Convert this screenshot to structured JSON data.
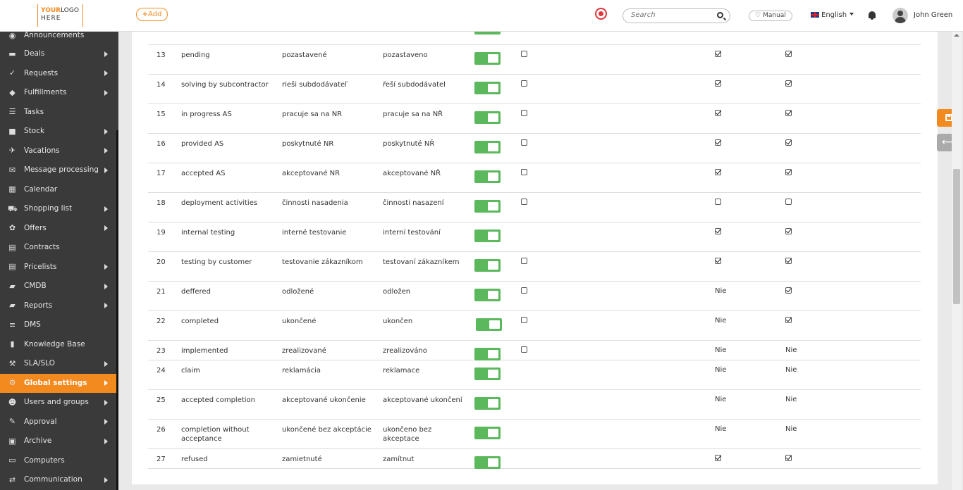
{
  "header": {
    "logo_line1_a": "YOUR",
    "logo_line1_b": "LOGO",
    "logo_line2": "HERE",
    "add_label": "Add",
    "search_placeholder": "Search",
    "manual_label": "Manual",
    "language": "English",
    "username": "John Green"
  },
  "sidebar": {
    "items": [
      {
        "label": "Announcements",
        "icon": "◉",
        "arrow": false
      },
      {
        "label": "Deals",
        "icon": "▬",
        "arrow": true
      },
      {
        "label": "Requests",
        "icon": "✓",
        "arrow": true
      },
      {
        "label": "Fulfillments",
        "icon": "◆",
        "arrow": true
      },
      {
        "label": "Tasks",
        "icon": "☰",
        "arrow": false
      },
      {
        "label": "Stock",
        "icon": "■",
        "arrow": true
      },
      {
        "label": "Vacations",
        "icon": "✈",
        "arrow": true
      },
      {
        "label": "Message processing",
        "icon": "✉",
        "arrow": true
      },
      {
        "label": "Calendar",
        "icon": "▦",
        "arrow": false
      },
      {
        "label": "Shopping list",
        "icon": "⛟",
        "arrow": true
      },
      {
        "label": "Offers",
        "icon": "✿",
        "arrow": true
      },
      {
        "label": "Contracts",
        "icon": "▤",
        "arrow": false
      },
      {
        "label": "Pricelists",
        "icon": "▤",
        "arrow": true
      },
      {
        "label": "CMDB",
        "icon": "▰",
        "arrow": true
      },
      {
        "label": "Reports",
        "icon": "▰",
        "arrow": true
      },
      {
        "label": "DMS",
        "icon": "≡",
        "arrow": false
      },
      {
        "label": "Knowledge Base",
        "icon": "▮",
        "arrow": false
      },
      {
        "label": "SLA/SLO",
        "icon": "⚒",
        "arrow": true
      },
      {
        "label": "Global settings",
        "icon": "⚙",
        "arrow": true,
        "active": true
      },
      {
        "label": "Users and groups",
        "icon": "☻",
        "arrow": true
      },
      {
        "label": "Approval",
        "icon": "✎",
        "arrow": true
      },
      {
        "label": "Archive",
        "icon": "▣",
        "arrow": true
      },
      {
        "label": "Computers",
        "icon": "▭",
        "arrow": false
      },
      {
        "label": "Communication",
        "icon": "⇄",
        "arrow": true
      }
    ]
  },
  "table": {
    "rows": [
      {
        "num": "13",
        "en": "pending",
        "sk": "pozastavené",
        "cz": "pozastaveno",
        "cb": true,
        "m1": "on",
        "m2": "on",
        "h": 42
      },
      {
        "num": "14",
        "en": "solving by subcontractor",
        "sk": "rieši subdodávateľ",
        "cz": "řeší subdodávatel",
        "cb": true,
        "m1": "on",
        "m2": "on",
        "h": 42
      },
      {
        "num": "15",
        "en": "in progress AS",
        "sk": "pracuje sa na NR",
        "cz": "pracuje sa na NŘ",
        "cb": true,
        "m1": "on",
        "m2": "on",
        "h": 42
      },
      {
        "num": "16",
        "en": "provided AS",
        "sk": "poskytnuté NR",
        "cz": "poskytnuté NŘ",
        "cb": true,
        "m1": "on",
        "m2": "on",
        "h": 42
      },
      {
        "num": "17",
        "en": "accepted AS",
        "sk": "akceptované NR",
        "cz": "akceptované NŘ",
        "cb": true,
        "m1": "on",
        "m2": "on",
        "h": 42
      },
      {
        "num": "18",
        "en": "deployment activities",
        "sk": "činnosti nasadenia",
        "cz": "činnosti nasazení",
        "cb": true,
        "m1": "off",
        "m2": "off",
        "h": 42
      },
      {
        "num": "19",
        "en": "internal testing",
        "sk": "interné testovanie",
        "cz": "interní testování",
        "cb": false,
        "m1": "on",
        "m2": "on",
        "h": 42
      },
      {
        "num": "20",
        "en": "testing by customer",
        "sk": "testovanie zákazníkom",
        "cz": "testovaní zákazníkem",
        "cb": true,
        "m1": "on",
        "m2": "on",
        "h": 42
      },
      {
        "num": "21",
        "en": "deffered",
        "sk": "odložené",
        "cz": "odložen",
        "cb": true,
        "m1": "Nie",
        "m2": "on",
        "h": 42
      },
      {
        "num": "22",
        "en": "completed",
        "sk": "ukončené",
        "cz": "ukončen",
        "cb": true,
        "m1": "Nie",
        "m2": "on",
        "h": 42
      },
      {
        "num": "23",
        "en": "implemented",
        "sk": "zrealizované",
        "cz": "zrealizováno",
        "cb": true,
        "m1": "Nie",
        "m2": "Nie",
        "h": 28
      },
      {
        "num": "24",
        "en": "claim",
        "sk": "reklamácia",
        "cz": "reklamace",
        "cb": false,
        "m1": "Nie",
        "m2": "Nie",
        "h": 42
      },
      {
        "num": "25",
        "en": "accepted completion",
        "sk": "akceptované ukončenie",
        "cz": "akceptované ukončení",
        "cb": false,
        "m1": "Nie",
        "m2": "Nie",
        "h": 42
      },
      {
        "num": "26",
        "en": "completion without acceptance",
        "sk": "ukončené bez akceptácie",
        "cz": "ukončeno bez akceptace",
        "cb": false,
        "m1": "Nie",
        "m2": "Nie",
        "h": 42
      },
      {
        "num": "27",
        "en": "refused",
        "sk": "zamietnuté",
        "cz": "zamítnut",
        "cb": false,
        "m1": "on",
        "m2": "on",
        "h": 28
      }
    ]
  },
  "colors": {
    "accent": "#f28a20",
    "toggle_on": "#5cb85c",
    "sidebar_bg": "#3a3a3a"
  },
  "icons": {
    "search": "search-icon",
    "bell": "bell-icon",
    "save": "save-icon",
    "back": "arrow-left-icon"
  },
  "back_symbol": "⟵"
}
